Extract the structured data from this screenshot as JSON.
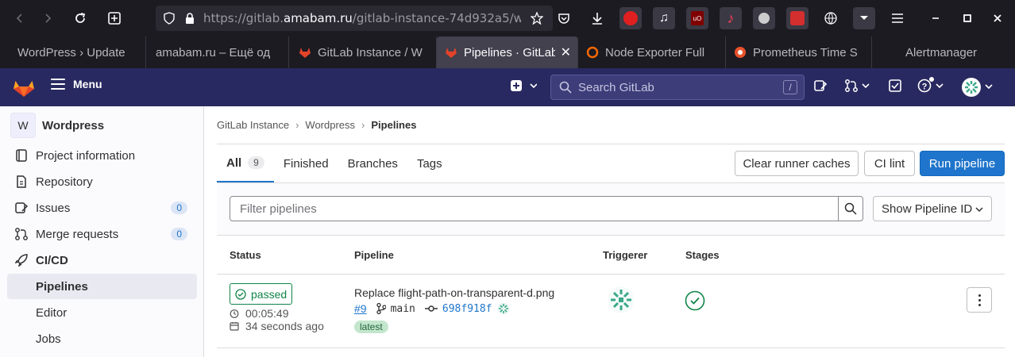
{
  "browser": {
    "url_prefix": "https://gitlab.",
    "url_domain": "amabam.ru",
    "url_suffix": "/gitlab-instance-74d932a5/wo",
    "tabs": [
      {
        "label": "WordPress › Update",
        "active": false
      },
      {
        "label": "amabam.ru – Ещё од",
        "active": false
      },
      {
        "label": "GitLab Instance / W",
        "active": false
      },
      {
        "label": "Pipelines · GitLab",
        "active": true
      },
      {
        "label": "Node Exporter Full",
        "active": false
      },
      {
        "label": "Prometheus Time S",
        "active": false
      },
      {
        "label": "Alertmanager",
        "active": false
      }
    ]
  },
  "header": {
    "menu_label": "Menu",
    "search_placeholder": "Search GitLab",
    "search_shortcut": "/"
  },
  "sidebar": {
    "project_initial": "W",
    "project_name": "Wordpress",
    "items": [
      {
        "label": "Project information"
      },
      {
        "label": "Repository"
      },
      {
        "label": "Issues",
        "count": "0"
      },
      {
        "label": "Merge requests",
        "count": "0"
      },
      {
        "label": "CI/CD"
      },
      {
        "label": "Pipelines"
      },
      {
        "label": "Editor"
      },
      {
        "label": "Jobs"
      }
    ]
  },
  "breadcrumb": [
    "GitLab Instance",
    "Wordpress",
    "Pipelines"
  ],
  "tabs": [
    {
      "label": "All",
      "count": "9"
    },
    {
      "label": "Finished"
    },
    {
      "label": "Branches"
    },
    {
      "label": "Tags"
    }
  ],
  "actions": {
    "clear_caches": "Clear runner caches",
    "ci_lint": "CI lint",
    "run_pipeline": "Run pipeline"
  },
  "filter": {
    "placeholder": "Filter pipelines",
    "show_id": "Show Pipeline ID"
  },
  "table": {
    "headers": [
      "Status",
      "Pipeline",
      "Triggerer",
      "Stages"
    ],
    "rows": [
      {
        "status": "passed",
        "duration": "00:05:49",
        "finished": "34 seconds ago",
        "title": "Replace flight-path-on-transparent-d.png",
        "id": "#9",
        "branch": "main",
        "sha": "698f918f",
        "tag": "latest"
      }
    ]
  },
  "colors": {
    "header_bg": "#292961",
    "primary": "#1f75cb",
    "success": "#108548"
  }
}
